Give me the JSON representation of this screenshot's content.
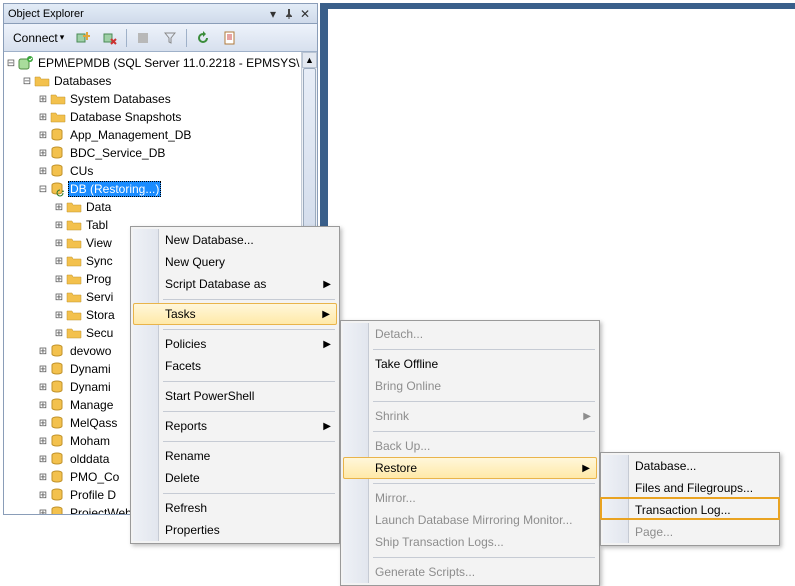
{
  "panel": {
    "title": "Object Explorer",
    "connect_label": "Connect"
  },
  "tree": {
    "server_label": "EPM\\EPMDB (SQL Server 11.0.2218 - EPMSYS\\",
    "databases_label": "Databases",
    "items": [
      "System Databases",
      "Database Snapshots",
      "App_Management_DB",
      "BDC_Service_DB",
      "CUs"
    ],
    "selected_label": "DB (Restoring...)",
    "sub_items": [
      "Data",
      "Tabl",
      "View",
      "Sync",
      "Prog",
      "Servi",
      "Stora",
      "Secu"
    ],
    "after_items": [
      "devowo",
      "Dynami",
      "Dynami",
      "Manage",
      "MelQass",
      "Moham",
      "olddata",
      "PMO_Co",
      "Profile D",
      "ProjectWebApp"
    ]
  },
  "menu1": {
    "items": [
      {
        "label": "New Database...",
        "type": "item"
      },
      {
        "label": "New Query",
        "type": "item"
      },
      {
        "label": "Script Database as",
        "type": "sub"
      },
      {
        "type": "sep"
      },
      {
        "label": "Tasks",
        "type": "sub",
        "hover": true
      },
      {
        "type": "sep"
      },
      {
        "label": "Policies",
        "type": "sub"
      },
      {
        "label": "Facets",
        "type": "item"
      },
      {
        "type": "sep"
      },
      {
        "label": "Start PowerShell",
        "type": "item"
      },
      {
        "type": "sep"
      },
      {
        "label": "Reports",
        "type": "sub"
      },
      {
        "type": "sep"
      },
      {
        "label": "Rename",
        "type": "item"
      },
      {
        "label": "Delete",
        "type": "item"
      },
      {
        "type": "sep"
      },
      {
        "label": "Refresh",
        "type": "item"
      },
      {
        "label": "Properties",
        "type": "item"
      }
    ]
  },
  "menu2": {
    "items": [
      {
        "label": "Detach...",
        "disabled": true
      },
      {
        "type": "sep"
      },
      {
        "label": "Take Offline"
      },
      {
        "label": "Bring Online",
        "disabled": true
      },
      {
        "type": "sep"
      },
      {
        "label": "Shrink",
        "type": "sub",
        "disabled": true
      },
      {
        "type": "sep"
      },
      {
        "label": "Back Up...",
        "disabled": true
      },
      {
        "label": "Restore",
        "type": "sub",
        "hover": true
      },
      {
        "type": "sep"
      },
      {
        "label": "Mirror...",
        "disabled": true
      },
      {
        "label": "Launch Database Mirroring Monitor...",
        "disabled": true
      },
      {
        "label": "Ship Transaction Logs...",
        "disabled": true
      },
      {
        "type": "sep"
      },
      {
        "label": "Generate Scripts...",
        "disabled": true
      }
    ]
  },
  "menu3": {
    "items": [
      {
        "label": "Database..."
      },
      {
        "label": "Files and Filegroups..."
      },
      {
        "label": "Transaction Log...",
        "highlight": true
      },
      {
        "label": "Page...",
        "disabled": true
      }
    ]
  }
}
